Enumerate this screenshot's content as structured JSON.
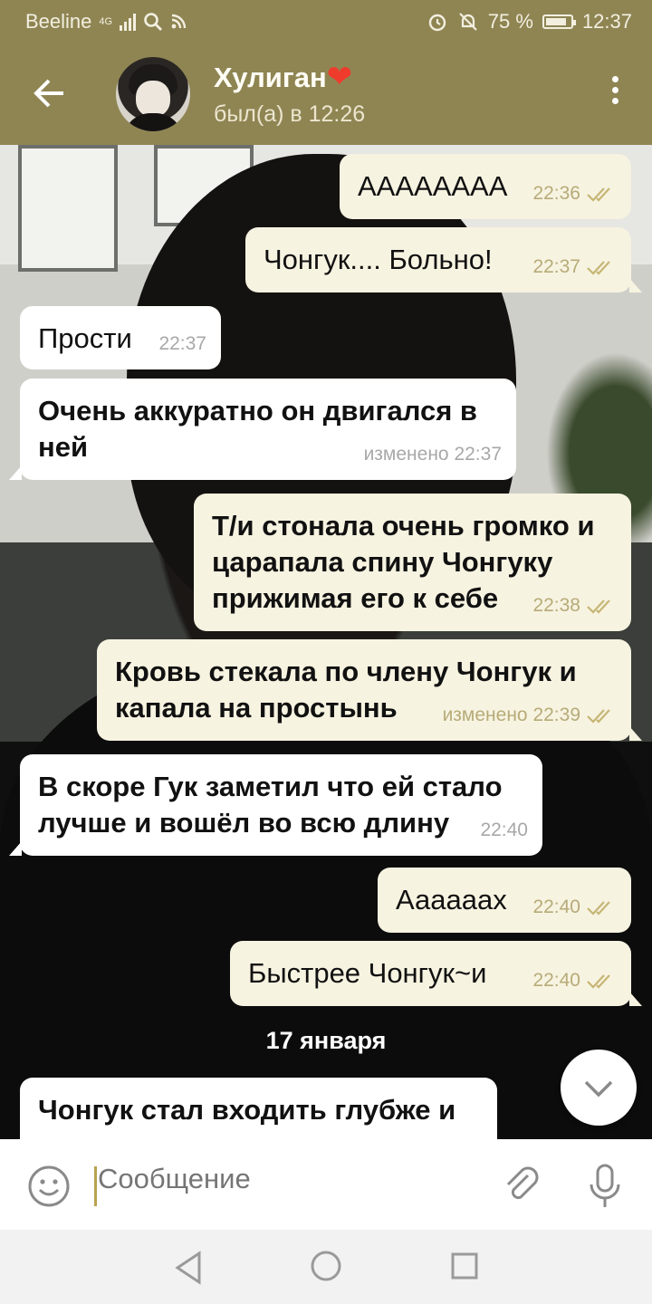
{
  "status_bar": {
    "carrier": "Beeline",
    "network": "4G",
    "battery": "75 %",
    "time": "12:37"
  },
  "header": {
    "contact_name": "Хулиган",
    "contact_status": "был(а) в 12:26"
  },
  "messages": [
    {
      "text": "АААААААА",
      "time": "22:36"
    },
    {
      "text": "Чонгук.... Больно!",
      "time": "22:37"
    },
    {
      "text": "Прости",
      "time": "22:37"
    },
    {
      "text": "Очень аккуратно он двигался в ней",
      "time": "изменено 22:37"
    },
    {
      "text": "Т/и стонала очень громко и царапала спину Чонгуку прижимая его к себе",
      "time": "22:38"
    },
    {
      "text": "Кровь стекала по члену Чонгук и капала на простынь",
      "time": "изменено 22:39"
    },
    {
      "text": "В скоре Гук заметил что ей стало лучше и вошёл во всю длину",
      "time": "22:40"
    },
    {
      "text": "Аааааах",
      "time": "22:40"
    },
    {
      "text": "Быстрее Чонгук~и",
      "time": "22:40"
    },
    {
      "text": "Чонгук стал входить глубже и",
      "time": ""
    }
  ],
  "date_separator": "17 января",
  "input": {
    "placeholder": "Сообщение"
  },
  "colors": {
    "header": "#8f8553",
    "outgoing_bubble": "#f7f3e1",
    "incoming_bubble": "#ffffff",
    "read_ticks": "#b7ab78"
  },
  "icons": [
    "back-arrow-icon",
    "more-vert-icon",
    "double-check-icon",
    "chevron-down-icon",
    "emoji-icon",
    "paperclip-icon",
    "microphone-icon",
    "nav-back-icon",
    "nav-home-icon",
    "nav-recent-icon"
  ]
}
